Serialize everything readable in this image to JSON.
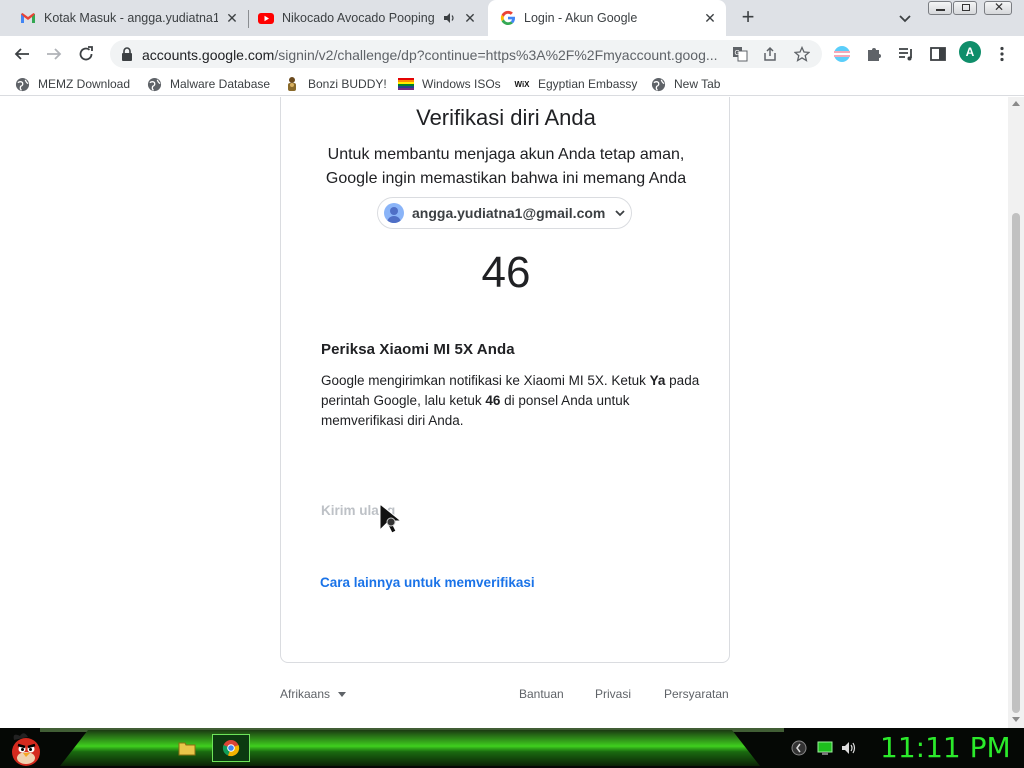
{
  "tabs": [
    {
      "title": "Kotak Masuk - angga.yudiatna1@",
      "icon": "gmail-icon"
    },
    {
      "title": "Nikocado Avocado Pooping",
      "icon": "youtube-icon",
      "audio": true
    },
    {
      "title": "Login - Akun Google",
      "icon": "google-icon",
      "active": true
    }
  ],
  "toolbar": {
    "url_main": "accounts.google.com",
    "url_rest": "/signin/v2/challenge/dp?continue=https%3A%2F%2Fmyaccount.goog...",
    "profile_initial": "A"
  },
  "bookmarks": [
    {
      "label": "MEMZ Download",
      "icon": "globe-icon"
    },
    {
      "label": "Malware Database",
      "icon": "globe-icon"
    },
    {
      "label": "Bonzi BUDDY!",
      "icon": "bonzi-icon"
    },
    {
      "label": "Windows ISOs",
      "icon": "rainbow-flag-icon"
    },
    {
      "label": "Egyptian Embassy",
      "icon": "wix-icon"
    },
    {
      "label": "New Tab",
      "icon": "globe-icon"
    }
  ],
  "wix_text": "WiX",
  "card": {
    "heading": "Verifikasi diri Anda",
    "subtitle": "Untuk membantu menjaga akun Anda tetap aman, Google ingin memastikan bahwa ini memang Anda",
    "email": "angga.yudiatna1@gmail.com",
    "number": "46",
    "check_title": "Periksa Xiaomi MI 5X Anda",
    "instr_1": "Google mengirimkan notifikasi ke Xiaomi MI 5X. Ketuk ",
    "instr_bold_1": "Ya",
    "instr_2": " pada perintah Google, lalu ketuk ",
    "instr_bold_2": "46",
    "instr_3": " di ponsel Anda untuk memverifikasi diri Anda.",
    "resend": "Kirim ulang",
    "alt_link": "Cara lainnya untuk memverifikasi"
  },
  "footer": {
    "language": "Afrikaans",
    "help": "Bantuan",
    "privacy": "Privasi",
    "terms": "Persyaratan"
  },
  "taskbar": {
    "clock": "11:11 PM"
  },
  "colors": {
    "link": "#1a73e8",
    "clock": "#2bea2b",
    "avatar": "#0f8e6a"
  }
}
